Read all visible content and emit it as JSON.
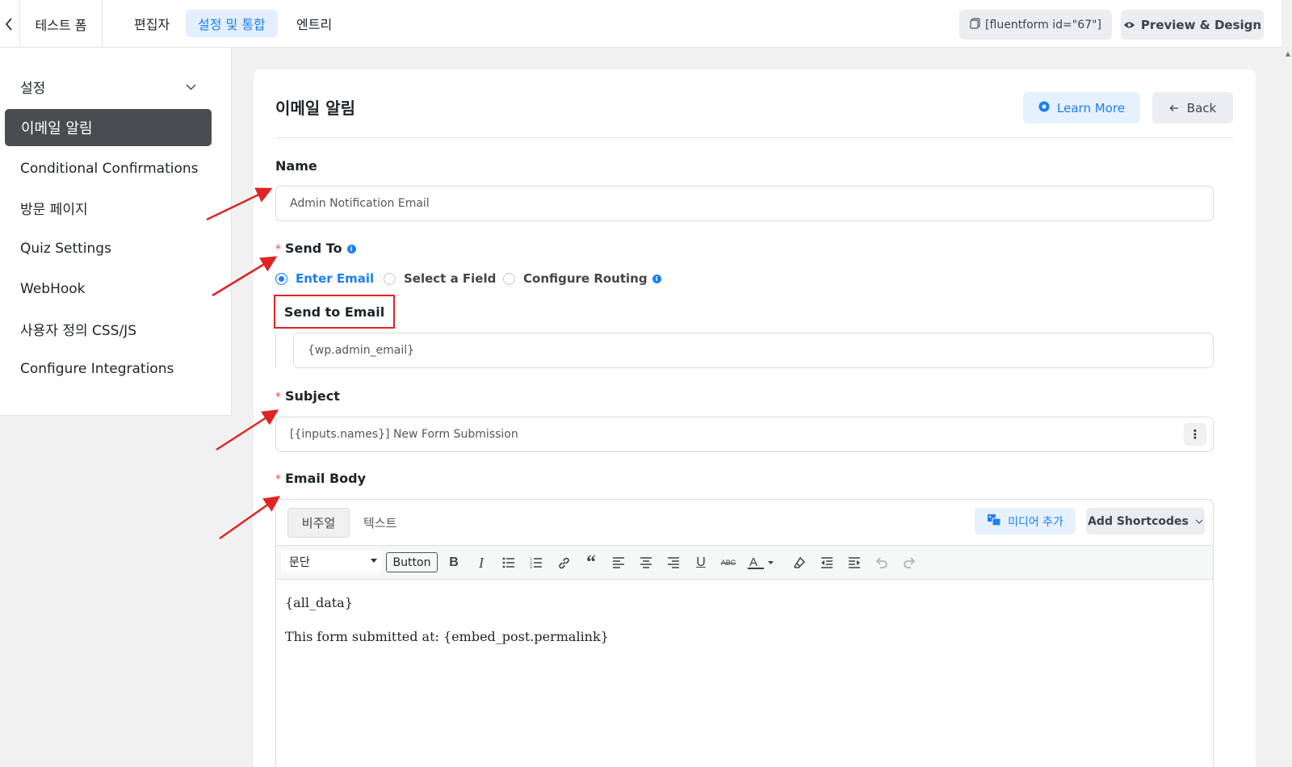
{
  "topbar": {
    "form_title": "테스트 폼",
    "tabs": [
      {
        "label": "편집자"
      },
      {
        "label": "설정 및 통합"
      },
      {
        "label": "엔트리"
      }
    ],
    "shortcode": "[fluentform id=\"67\"]",
    "preview_label": "Preview & Design"
  },
  "sidebar": {
    "items": [
      {
        "label": "설정"
      },
      {
        "label": "이메일 알림"
      },
      {
        "label": "Conditional Confirmations"
      },
      {
        "label": "방문 페이지"
      },
      {
        "label": "Quiz Settings"
      },
      {
        "label": "WebHook"
      },
      {
        "label": "사용자 정의 CSS/JS"
      },
      {
        "label": "Configure Integrations"
      }
    ]
  },
  "main": {
    "title": "이메일 알림",
    "learn_more": "Learn More",
    "back": "Back",
    "name_label": "Name",
    "name_value": "Admin Notification Email",
    "send_to_label": "Send To",
    "send_to_options": [
      {
        "label": "Enter Email",
        "checked": true
      },
      {
        "label": "Select a Field",
        "checked": false
      },
      {
        "label": "Configure Routing",
        "checked": false
      }
    ],
    "send_to_email_label": "Send to Email",
    "send_to_email_value": "{wp.admin_email}",
    "subject_label": "Subject",
    "subject_value": "[{inputs.names}] New Form Submission",
    "email_body_label": "Email Body"
  },
  "editor": {
    "tab_visual": "비주얼",
    "tab_text": "텍스트",
    "media_button": "미디어 추가",
    "shortcodes_button": "Add Shortcodes",
    "format_value": "문단",
    "button_label": "Button",
    "content": [
      "{all_data}",
      "This form submitted at: {embed_post.permalink}"
    ]
  },
  "colors": {
    "accent": "#1a7efb",
    "sidebar_active": "#4a4c4f",
    "annotation": "#e02424"
  }
}
